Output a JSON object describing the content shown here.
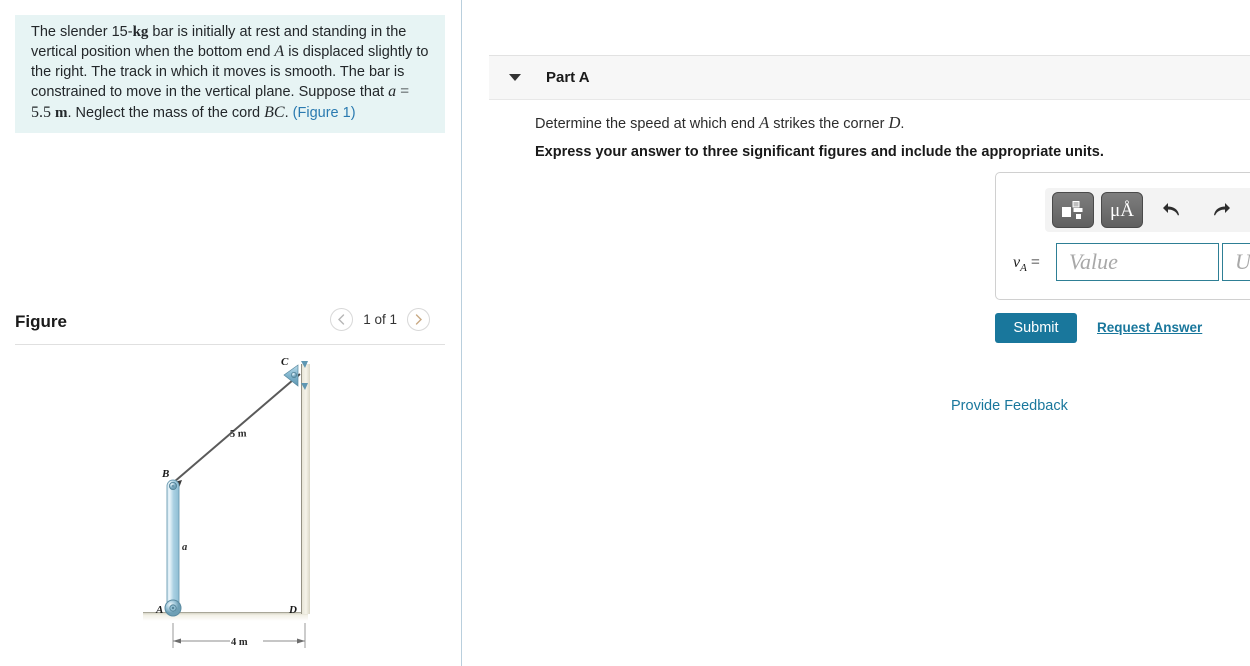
{
  "problem": {
    "line1_a": "The slender 15-",
    "line1_b": "kg",
    "line1_c": " bar is initially at rest and standing in the vertical position when the bottom end ",
    "var_A": "A",
    "line2": " is displaced slightly to the right. The track in which it moves is smooth. The bar is constrained to move in the vertical plane. Suppose that ",
    "var_a": "a",
    "eq_value": " = 5.5 ",
    "unit_m": "m",
    "line3": ". Neglect the mass of the cord ",
    "var_BC": "BC",
    "period": ".",
    "figure_link": "(Figure 1)"
  },
  "figure_panel": {
    "title": "Figure",
    "prev_icon": "chevron-left-icon",
    "next_icon": "chevron-right-icon",
    "count_label": "1 of 1"
  },
  "diagram": {
    "label_A": "A",
    "label_B": "B",
    "label_C": "C",
    "label_D": "D",
    "label_a": "a",
    "cord_length": "5 m",
    "base_length": "4 m"
  },
  "part_a": {
    "caret_icon": "caret-down-icon",
    "title": "Part A",
    "question_pre": "Determine the speed at which end ",
    "question_var_A": "A",
    "question_mid": " strikes the corner ",
    "question_var_D": "D",
    "question_end": ".",
    "instruction": "Express your answer to three significant figures and include the appropriate units."
  },
  "answer_widget": {
    "toolbar": {
      "template_icon": "math-template-icon",
      "units_icon": "greek-units-icon",
      "units_label": "μÅ",
      "undo_icon": "undo-icon",
      "redo_icon": "redo-icon",
      "reset_icon": "reset-icon",
      "keyboard_icon": "keyboard-icon",
      "help_icon": "help-icon",
      "help_label": "?"
    },
    "answer_symbol": "v",
    "answer_subscript": "A",
    "equals": "=",
    "value_placeholder": "Value",
    "units_placeholder": "Units"
  },
  "actions": {
    "submit_label": "Submit",
    "request_answer_label": "Request Answer",
    "provide_feedback_label": "Provide Feedback"
  },
  "colors": {
    "accent_teal": "#19779c",
    "problem_bg": "#e7f4f4",
    "band_bg": "#f7f7f7",
    "input_border": "#2e7f95",
    "bar_blue": "#a8cfe0"
  }
}
